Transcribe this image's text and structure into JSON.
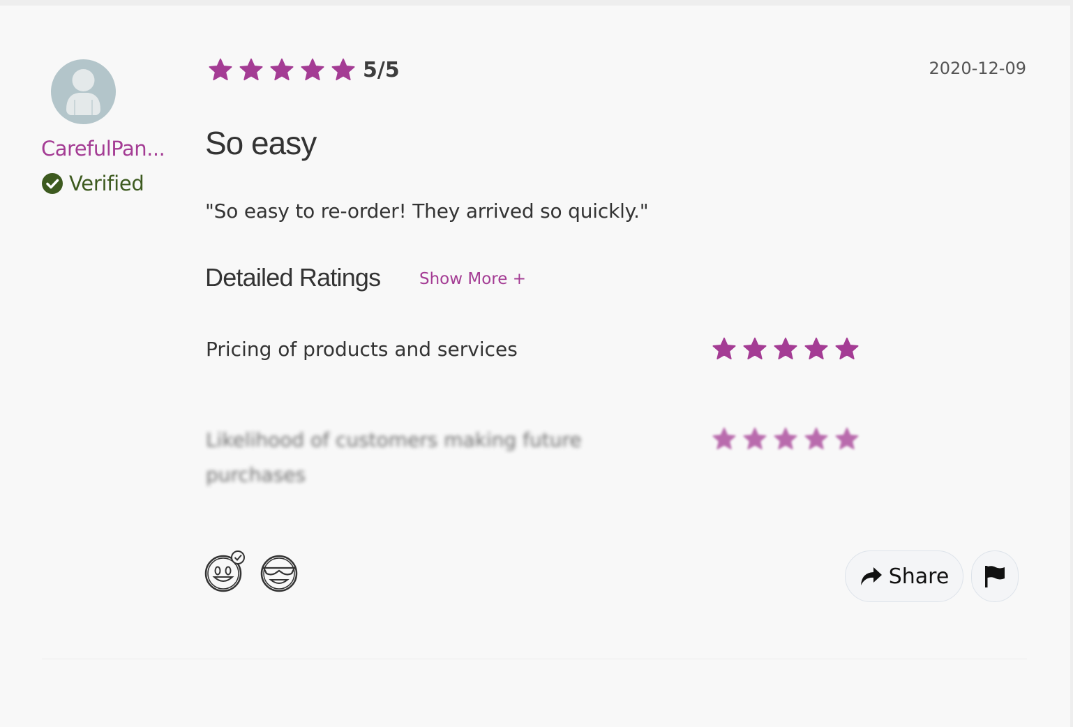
{
  "reviewer": {
    "name": "CarefulPan...",
    "verified_label": "Verified"
  },
  "review": {
    "overall_rating_value": 5,
    "overall_rating_max": 5,
    "rating_text": "5/5",
    "date": "2020-12-09",
    "title": "So easy",
    "body": "\"So easy to re-order! They arrived so quickly.\""
  },
  "detailed_ratings": {
    "heading": "Detailed Ratings",
    "show_more_label": "Show More +",
    "rows": [
      {
        "label": "Pricing of products and services",
        "stars": 5
      },
      {
        "label": "Likelihood of customers making future purchases",
        "stars": 5
      }
    ]
  },
  "actions": {
    "share_label": "Share"
  },
  "colors": {
    "accent": "#a43c94",
    "verified": "#3d5a1f",
    "avatar_bg": "#b3c5ca"
  },
  "icons": {
    "avatar": "user-silhouette-icon",
    "verified": "check-circle-icon",
    "star": "star-icon",
    "reaction_1": "helpful-face-icon",
    "reaction_2": "cool-face-icon",
    "share": "share-arrow-icon",
    "flag": "flag-icon"
  }
}
